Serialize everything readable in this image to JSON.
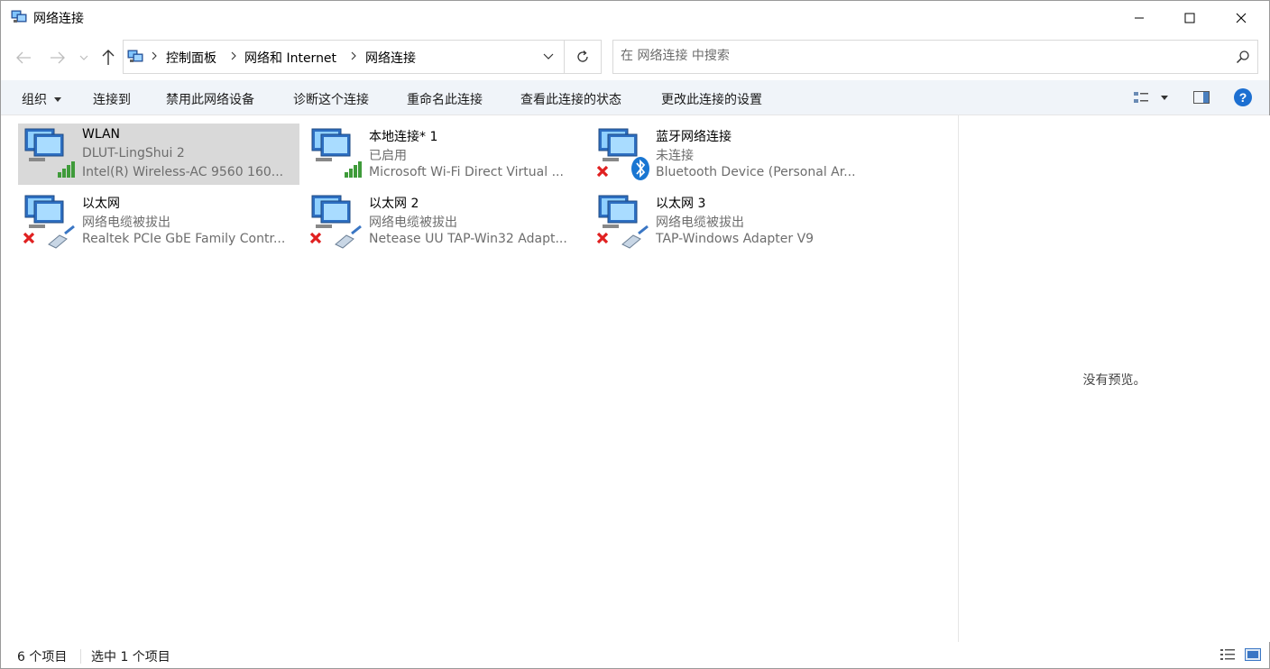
{
  "window": {
    "title": "网络连接"
  },
  "breadcrumb": {
    "items": [
      "控制面板",
      "网络和 Internet",
      "网络连接"
    ]
  },
  "search": {
    "placeholder": "在 网络连接 中搜索"
  },
  "commandbar": {
    "organize": "组织",
    "connect_to": "连接到",
    "disable": "禁用此网络设备",
    "diagnose": "诊断这个连接",
    "rename": "重命名此连接",
    "view_status": "查看此连接的状态",
    "change_settings": "更改此连接的设置"
  },
  "connections": [
    {
      "name": "WLAN",
      "status": "DLUT-LingShui 2",
      "device": "Intel(R) Wireless-AC 9560 160...",
      "type": "wifi",
      "selected": true
    },
    {
      "name": "本地连接* 1",
      "status": "已启用",
      "device": "Microsoft Wi-Fi Direct Virtual ...",
      "type": "wifi",
      "selected": false
    },
    {
      "name": "蓝牙网络连接",
      "status": "未连接",
      "device": "Bluetooth Device (Personal Ar...",
      "type": "bluetooth",
      "selected": false
    },
    {
      "name": "以太网",
      "status": "网络电缆被拔出",
      "device": "Realtek PCIe GbE Family Contr...",
      "type": "ethernet",
      "selected": false
    },
    {
      "name": "以太网 2",
      "status": "网络电缆被拔出",
      "device": "Netease UU TAP-Win32 Adapt...",
      "type": "ethernet",
      "selected": false
    },
    {
      "name": "以太网 3",
      "status": "网络电缆被拔出",
      "device": "TAP-Windows Adapter V9",
      "type": "ethernet",
      "selected": false
    }
  ],
  "preview": {
    "text": "没有预览。"
  },
  "statusbar": {
    "count": "6 个项目",
    "selected": "选中 1 个项目"
  },
  "colors": {
    "selection": "#d9d9d9",
    "commandbar_bg": "#f0f4f9",
    "help_blue": "#1c6fd1",
    "error_red": "#e02020",
    "signal_green": "#3f9b3a"
  }
}
